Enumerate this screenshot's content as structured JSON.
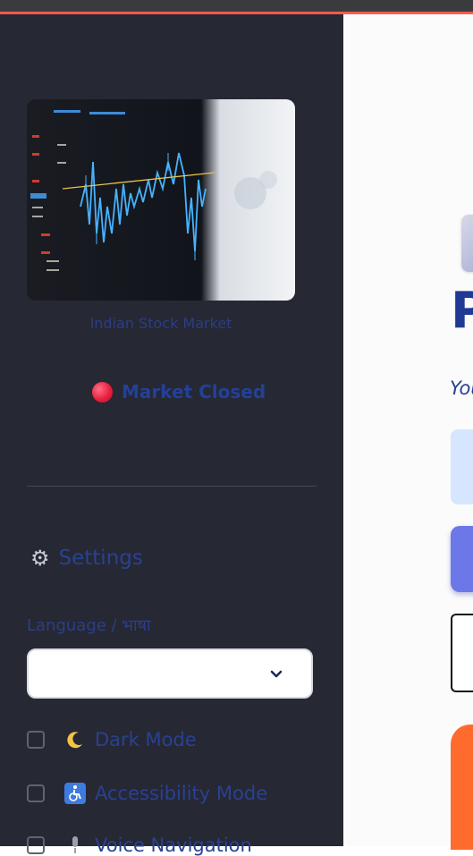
{
  "sidebar": {
    "image_alt": "Indian Stock Market",
    "image_caption": "Indian Stock Market",
    "market_status": {
      "label": "Market Closed",
      "color": "#e8203e"
    },
    "settings": {
      "title": "Settings",
      "icon": "gear-icon",
      "language_label": "Language / भाषा",
      "language_value": "",
      "options": [
        {
          "label": "Dark Mode",
          "icon": "moon-icon",
          "checked": false
        },
        {
          "label": "Accessibility Mode",
          "icon": "wheelchair-icon",
          "checked": false
        },
        {
          "label": "Voice Navigation",
          "icon": "microphone-icon",
          "checked": false
        }
      ]
    }
  },
  "main": {
    "title_fragment": "P",
    "subtitle_fragment": "You"
  },
  "colors": {
    "sidebar_bg": "#262833",
    "accent": "#ff5a4e",
    "text_blue": "#2a4192"
  }
}
